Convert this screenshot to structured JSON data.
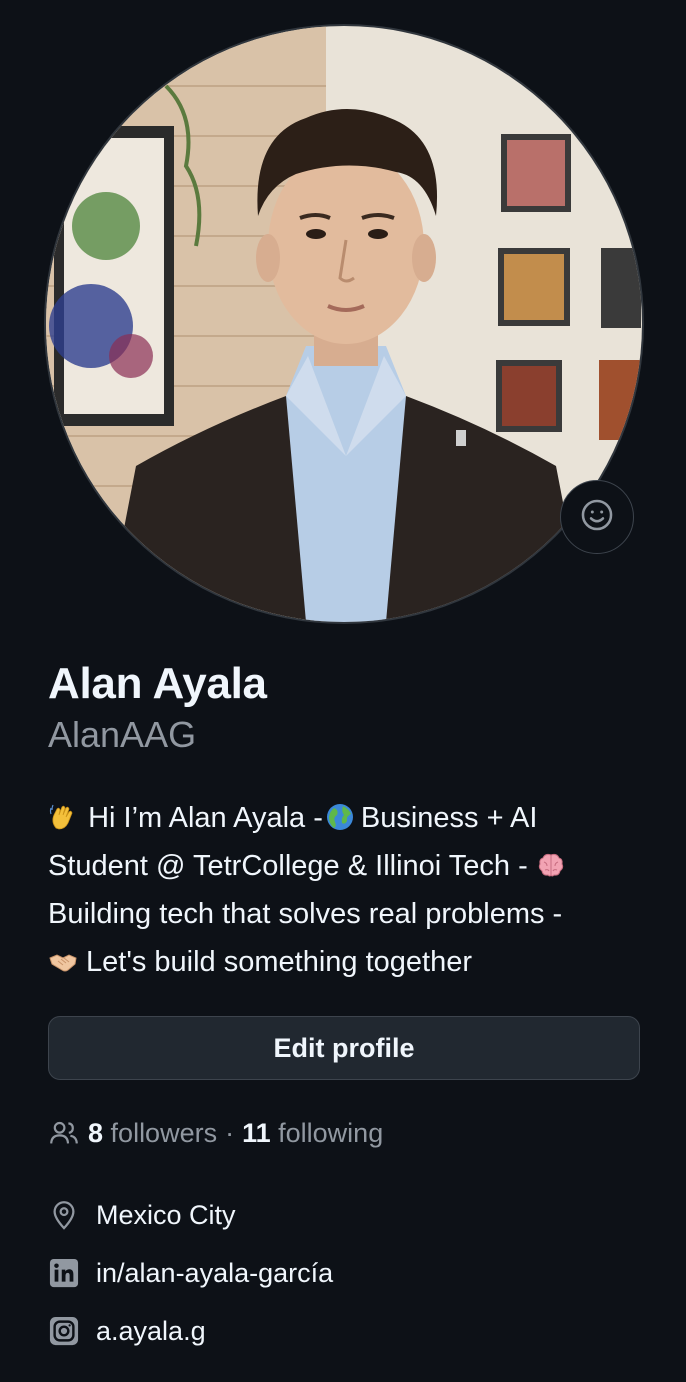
{
  "profile": {
    "full_name": "Alan Ayala",
    "username": "AlanAAG",
    "avatar_alt": "Alan Ayala profile photo",
    "status_icon": "smiley-icon"
  },
  "bio": {
    "lines": [
      [
        "wave-emoji",
        "Hi I’m Alan Ayala -",
        "globe-emoji",
        "Business + AI"
      ],
      [
        "Student @ TetrCollege & Illinoi Tech - ",
        "brain-emoji"
      ],
      [
        "Building tech that solves real problems -"
      ],
      [
        "handshake-emoji",
        "Let's build something together"
      ]
    ],
    "line1_a": "Hi I’m Alan Ayala -",
    "line1_b": "Business + AI",
    "line2": "Student @ TetrCollege & Illinoi Tech -",
    "line3": "Building tech that solves real problems -",
    "line4": "Let's build something together"
  },
  "actions": {
    "edit_profile_label": "Edit profile"
  },
  "social": {
    "followers_count": "8",
    "followers_label": "followers",
    "separator": "·",
    "following_count": "11",
    "following_label": "following"
  },
  "details": {
    "location": "Mexico City",
    "linkedin": "in/alan-ayala-garcía",
    "instagram": "a.ayala.g"
  },
  "colors": {
    "background": "#0d1117",
    "text_primary": "#f0f6fc",
    "text_muted": "#9198a1",
    "button_bg": "#212830",
    "border": "#3d444d"
  }
}
